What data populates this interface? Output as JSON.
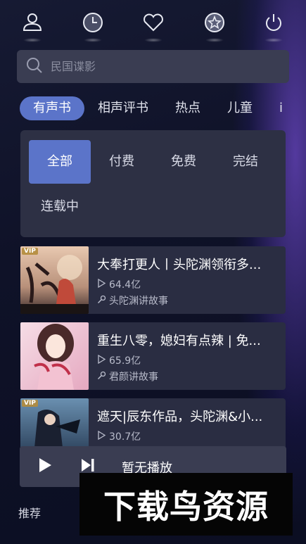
{
  "search": {
    "placeholder": "民国谍影"
  },
  "tabs": [
    {
      "label": "有声书",
      "active": true
    },
    {
      "label": "相声评书"
    },
    {
      "label": "热点"
    },
    {
      "label": "儿童"
    },
    {
      "label": "i"
    }
  ],
  "filters": [
    {
      "label": "全部",
      "active": true
    },
    {
      "label": "付费"
    },
    {
      "label": "免费"
    },
    {
      "label": "完结"
    },
    {
      "label": "连载中"
    }
  ],
  "books": [
    {
      "badge": "VIP",
      "title": "大奉打更人丨头陀渊领衔多...",
      "plays": "64.4亿",
      "author": "头陀渊讲故事"
    },
    {
      "title": "重生八零，媳妇有点辣 | 免...",
      "plays": "65.9亿",
      "author": "君颜讲故事"
    },
    {
      "badge": "VIP",
      "title": "遮天|辰东作品，头陀渊&小...",
      "plays": "30.7亿"
    }
  ],
  "player": {
    "status": "暂无播放"
  },
  "bottom": {
    "tab_label": "推荐"
  },
  "watermark": "下载鸟资源",
  "icons": {
    "top": [
      "user-icon",
      "clock-icon",
      "heart-icon",
      "star-icon",
      "power-icon"
    ]
  },
  "colors": {
    "accent": "#5b74c9",
    "panel": "#2d3044",
    "card": "#2a2d42"
  }
}
